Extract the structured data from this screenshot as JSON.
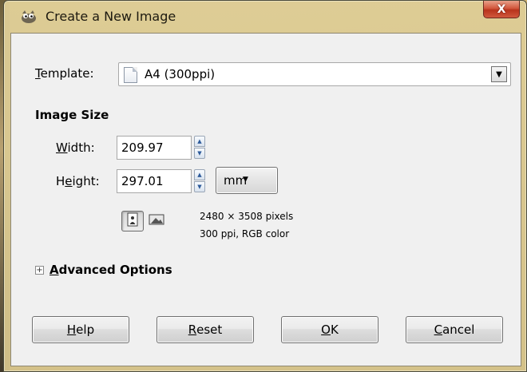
{
  "window": {
    "title": "Create a New Image",
    "close_label": "X"
  },
  "template": {
    "label": "Template:",
    "label_mnemonic": "T",
    "label_rest": "emplate:",
    "selected": "A4 (300ppi)"
  },
  "image_size": {
    "heading": "Image Size",
    "width": {
      "label_mnemonic": "W",
      "label_rest": "idth:",
      "value": "209.97"
    },
    "height": {
      "label_before": "H",
      "label_mnemonic": "e",
      "label_rest": "ight:",
      "value": "297.01"
    },
    "unit": "mm",
    "info_line1": "2480 × 3508 pixels",
    "info_line2": "300 ppi, RGB color"
  },
  "advanced": {
    "expander_symbol": "+",
    "label_mnemonic": "A",
    "label_rest": "dvanced Options"
  },
  "buttons": {
    "help": {
      "mnemonic": "H",
      "rest": "elp"
    },
    "reset": {
      "mnemonic": "R",
      "rest": "eset"
    },
    "ok": {
      "mnemonic": "O",
      "rest": "K"
    },
    "cancel": {
      "mnemonic": "C",
      "rest": "ancel"
    }
  },
  "icons": {
    "app": "gimp-wilber-icon",
    "template_page": "page-icon",
    "portrait": "portrait-orientation-icon",
    "landscape": "landscape-orientation-icon",
    "combo_arrow": "chevron-down-icon"
  },
  "colors": {
    "close_button": "#d2573d",
    "window_frame": "#d8c28a",
    "client_bg": "#f0f0f0"
  }
}
